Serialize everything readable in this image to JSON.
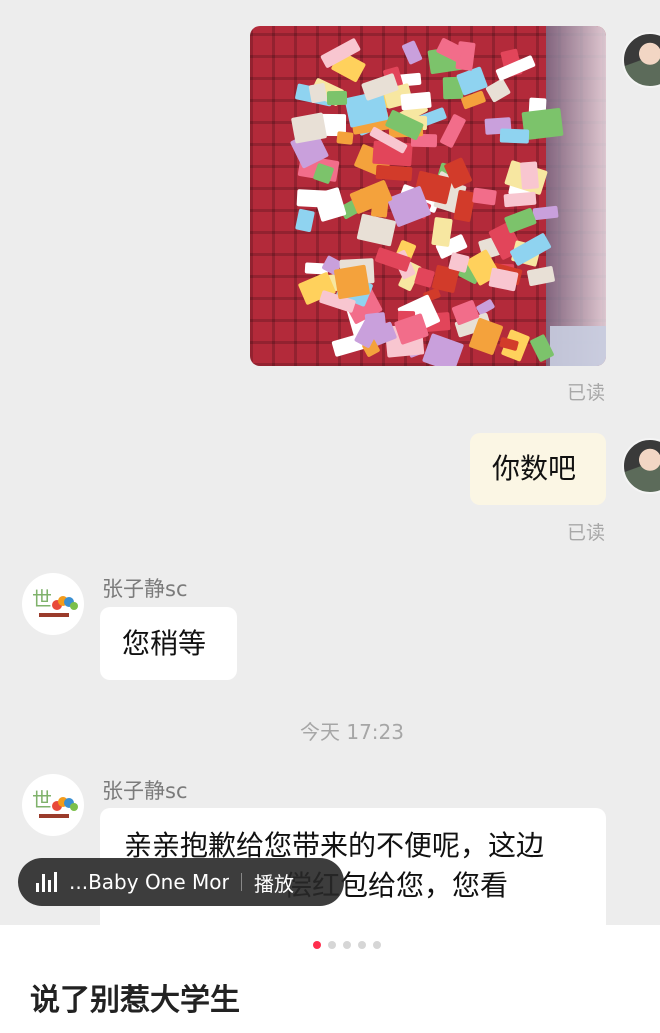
{
  "messages": {
    "read_label": "已读",
    "mine_text": "你数吧",
    "sender_name": "张子静sc",
    "reply_1": "您稍等",
    "timestamp": "今天 17:23",
    "reply_2_line1": "亲亲抱歉给您带来的不便呢，这边",
    "reply_2_line2": "偿红包给您，您看"
  },
  "music_player": {
    "title": "...Baby One More",
    "play_label": "播放",
    "icon": "audio-bars-icon"
  },
  "post": {
    "caption": "说了别惹大学生",
    "carousel_dots": 5,
    "carousel_active_index": 0
  },
  "colors": {
    "my_bubble": "#fbf6e4",
    "their_bubble": "#ffffff",
    "active_dot": "#ff2e4d"
  }
}
